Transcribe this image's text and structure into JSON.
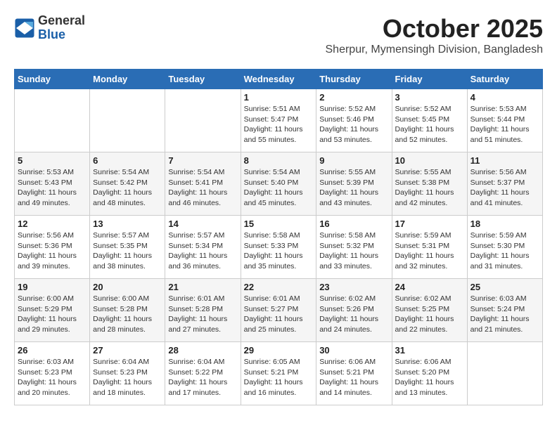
{
  "header": {
    "logo_general": "General",
    "logo_blue": "Blue",
    "month_title": "October 2025",
    "subtitle": "Sherpur, Mymensingh Division, Bangladesh"
  },
  "weekdays": [
    "Sunday",
    "Monday",
    "Tuesday",
    "Wednesday",
    "Thursday",
    "Friday",
    "Saturday"
  ],
  "weeks": [
    [
      {
        "day": "",
        "info": ""
      },
      {
        "day": "",
        "info": ""
      },
      {
        "day": "",
        "info": ""
      },
      {
        "day": "1",
        "info": "Sunrise: 5:51 AM\nSunset: 5:47 PM\nDaylight: 11 hours\nand 55 minutes."
      },
      {
        "day": "2",
        "info": "Sunrise: 5:52 AM\nSunset: 5:46 PM\nDaylight: 11 hours\nand 53 minutes."
      },
      {
        "day": "3",
        "info": "Sunrise: 5:52 AM\nSunset: 5:45 PM\nDaylight: 11 hours\nand 52 minutes."
      },
      {
        "day": "4",
        "info": "Sunrise: 5:53 AM\nSunset: 5:44 PM\nDaylight: 11 hours\nand 51 minutes."
      }
    ],
    [
      {
        "day": "5",
        "info": "Sunrise: 5:53 AM\nSunset: 5:43 PM\nDaylight: 11 hours\nand 49 minutes."
      },
      {
        "day": "6",
        "info": "Sunrise: 5:54 AM\nSunset: 5:42 PM\nDaylight: 11 hours\nand 48 minutes."
      },
      {
        "day": "7",
        "info": "Sunrise: 5:54 AM\nSunset: 5:41 PM\nDaylight: 11 hours\nand 46 minutes."
      },
      {
        "day": "8",
        "info": "Sunrise: 5:54 AM\nSunset: 5:40 PM\nDaylight: 11 hours\nand 45 minutes."
      },
      {
        "day": "9",
        "info": "Sunrise: 5:55 AM\nSunset: 5:39 PM\nDaylight: 11 hours\nand 43 minutes."
      },
      {
        "day": "10",
        "info": "Sunrise: 5:55 AM\nSunset: 5:38 PM\nDaylight: 11 hours\nand 42 minutes."
      },
      {
        "day": "11",
        "info": "Sunrise: 5:56 AM\nSunset: 5:37 PM\nDaylight: 11 hours\nand 41 minutes."
      }
    ],
    [
      {
        "day": "12",
        "info": "Sunrise: 5:56 AM\nSunset: 5:36 PM\nDaylight: 11 hours\nand 39 minutes."
      },
      {
        "day": "13",
        "info": "Sunrise: 5:57 AM\nSunset: 5:35 PM\nDaylight: 11 hours\nand 38 minutes."
      },
      {
        "day": "14",
        "info": "Sunrise: 5:57 AM\nSunset: 5:34 PM\nDaylight: 11 hours\nand 36 minutes."
      },
      {
        "day": "15",
        "info": "Sunrise: 5:58 AM\nSunset: 5:33 PM\nDaylight: 11 hours\nand 35 minutes."
      },
      {
        "day": "16",
        "info": "Sunrise: 5:58 AM\nSunset: 5:32 PM\nDaylight: 11 hours\nand 33 minutes."
      },
      {
        "day": "17",
        "info": "Sunrise: 5:59 AM\nSunset: 5:31 PM\nDaylight: 11 hours\nand 32 minutes."
      },
      {
        "day": "18",
        "info": "Sunrise: 5:59 AM\nSunset: 5:30 PM\nDaylight: 11 hours\nand 31 minutes."
      }
    ],
    [
      {
        "day": "19",
        "info": "Sunrise: 6:00 AM\nSunset: 5:29 PM\nDaylight: 11 hours\nand 29 minutes."
      },
      {
        "day": "20",
        "info": "Sunrise: 6:00 AM\nSunset: 5:28 PM\nDaylight: 11 hours\nand 28 minutes."
      },
      {
        "day": "21",
        "info": "Sunrise: 6:01 AM\nSunset: 5:28 PM\nDaylight: 11 hours\nand 27 minutes."
      },
      {
        "day": "22",
        "info": "Sunrise: 6:01 AM\nSunset: 5:27 PM\nDaylight: 11 hours\nand 25 minutes."
      },
      {
        "day": "23",
        "info": "Sunrise: 6:02 AM\nSunset: 5:26 PM\nDaylight: 11 hours\nand 24 minutes."
      },
      {
        "day": "24",
        "info": "Sunrise: 6:02 AM\nSunset: 5:25 PM\nDaylight: 11 hours\nand 22 minutes."
      },
      {
        "day": "25",
        "info": "Sunrise: 6:03 AM\nSunset: 5:24 PM\nDaylight: 11 hours\nand 21 minutes."
      }
    ],
    [
      {
        "day": "26",
        "info": "Sunrise: 6:03 AM\nSunset: 5:23 PM\nDaylight: 11 hours\nand 20 minutes."
      },
      {
        "day": "27",
        "info": "Sunrise: 6:04 AM\nSunset: 5:23 PM\nDaylight: 11 hours\nand 18 minutes."
      },
      {
        "day": "28",
        "info": "Sunrise: 6:04 AM\nSunset: 5:22 PM\nDaylight: 11 hours\nand 17 minutes."
      },
      {
        "day": "29",
        "info": "Sunrise: 6:05 AM\nSunset: 5:21 PM\nDaylight: 11 hours\nand 16 minutes."
      },
      {
        "day": "30",
        "info": "Sunrise: 6:06 AM\nSunset: 5:21 PM\nDaylight: 11 hours\nand 14 minutes."
      },
      {
        "day": "31",
        "info": "Sunrise: 6:06 AM\nSunset: 5:20 PM\nDaylight: 11 hours\nand 13 minutes."
      },
      {
        "day": "",
        "info": ""
      }
    ]
  ]
}
